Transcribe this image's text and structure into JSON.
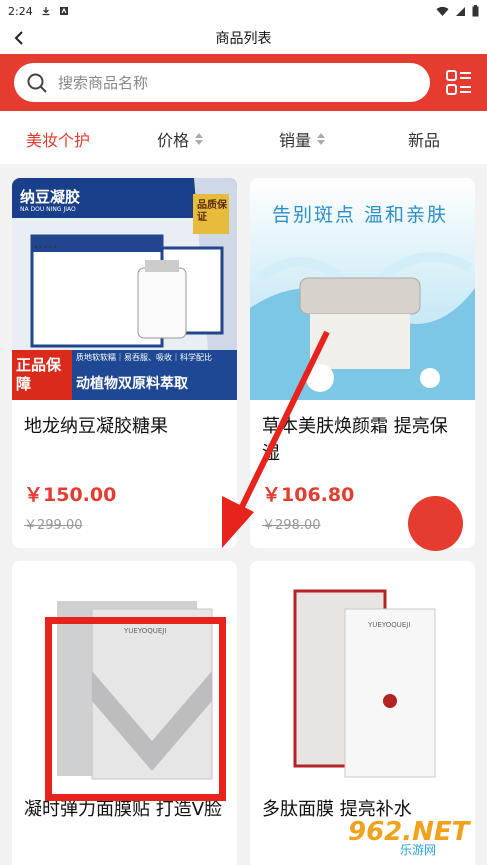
{
  "status": {
    "time": "2:24"
  },
  "header": {
    "title": "商品列表"
  },
  "search": {
    "placeholder": "搜索商品名称"
  },
  "filters": [
    {
      "label": "美妆个护",
      "active": true
    },
    {
      "label": "价格"
    },
    {
      "label": "销量"
    },
    {
      "label": "新品"
    }
  ],
  "products": [
    {
      "name": "地龙纳豆凝胶糖果",
      "price": "￥150.00",
      "original_price": "￥299.00",
      "image": {
        "brand": "纳豆凝胶",
        "brand_en": "NA DOU NING JIAO",
        "badge": "品质保证",
        "tag": "正品保障",
        "slogan": "动植物双原料萃取",
        "features": "质地软软糯｜易吞服、吸收｜科学配比"
      }
    },
    {
      "name": "草本美肤焕颜霜 提亮保湿",
      "price": "￥106.80",
      "original_price": "￥298.00",
      "image": {
        "headline": "告别斑点 温和亲肤"
      }
    },
    {
      "name": "凝时弹力面膜贴 打造V脸",
      "image": {
        "brand": "YUEYOQUEJI"
      }
    },
    {
      "name": "多肽面膜 提亮补水",
      "image": {
        "brand": "YUEYOQUEJI"
      }
    }
  ],
  "watermark": {
    "text": "962.NET",
    "subtitle": "乐游网"
  }
}
